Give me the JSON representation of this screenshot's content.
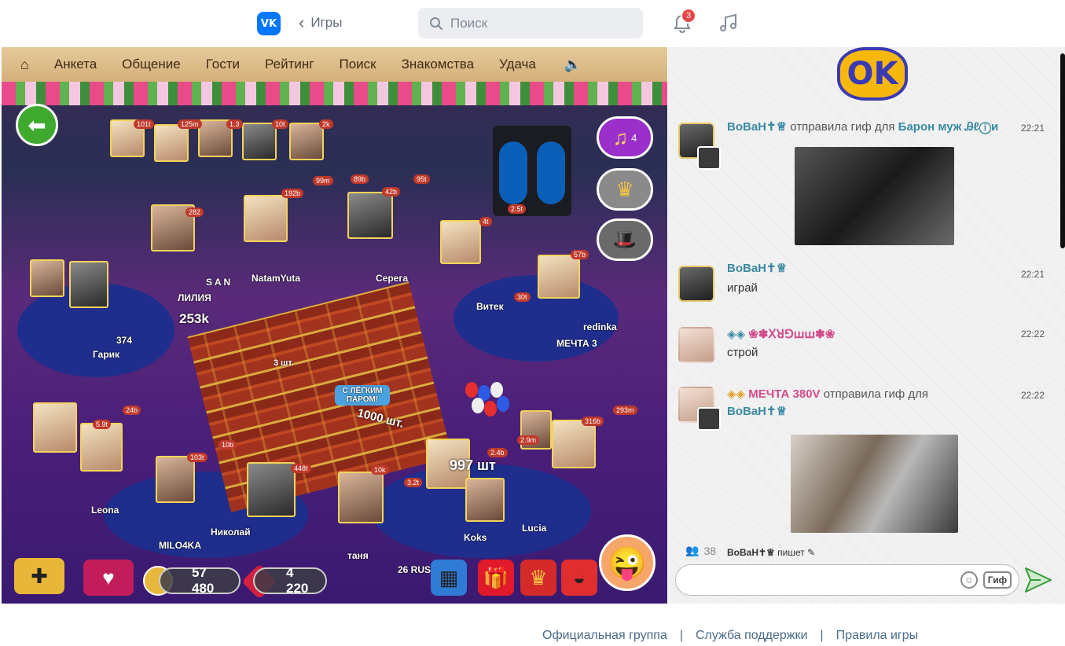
{
  "topbar": {
    "logo_text": "VK",
    "back_label": "Игры",
    "search_placeholder": "Поиск",
    "notifications_count": "3"
  },
  "game": {
    "nav": [
      "Анкета",
      "Общение",
      "Гости",
      "Рейтинг",
      "Поиск",
      "Знакомства",
      "Удача"
    ],
    "music_count": "4",
    "names": {
      "n1": "ЛИЛИЯ",
      "n2": "Гарик",
      "n3": "NatamYuta",
      "n4": "Серега",
      "n5": "Витек",
      "n6": "МЕЧТА 3",
      "n7": "Leona",
      "n8": "Николай",
      "n9": "MILO4KA",
      "n10": "таня",
      "n11": "Koks",
      "n12": "Lucia",
      "n13": "S A N",
      "n14": "redinka",
      "n15": "26 RUS"
    },
    "values": {
      "v1": "253k",
      "v2": "374",
      "v3": "3 шт.",
      "v4": "1000 шт.",
      "v5": "997 шт",
      "v6": "С ЛЁГКИМ ПАРОМ!",
      "t1": "101t",
      "t2": "125m",
      "t3": "10t",
      "t4": "2k",
      "t5": "192b",
      "t6": "282",
      "t7": "99m",
      "t8": "89b",
      "t9": "42b",
      "t10": "95t",
      "t11": "2.5t",
      "t12": "57b",
      "t13": "24b",
      "t14": "5.9t",
      "t15": "103t",
      "t16": "10b",
      "t17": "448t",
      "t18": "10k",
      "t19": "3.2t",
      "t20": "2.4b",
      "t21": "2.9m",
      "t22": "316b",
      "t23": "293m",
      "t24": "1.3",
      "t25": "4t",
      "t26": "30t"
    },
    "coins_amount": "57 480",
    "rubies_amount": "4 220"
  },
  "chat": {
    "messages": [
      {
        "nick": "BoBaH✝♕",
        "action": "отправила гиф для",
        "target": "Барон муж Ꭿℓⓘи",
        "time": "22:21"
      },
      {
        "nick": "BoBaH✝♕",
        "text": "играй",
        "time": "22:21"
      },
      {
        "nick": "❀✽ꓫꓤꓨꟺꟺ✽❀",
        "text": "строй",
        "time": "22:22"
      },
      {
        "nick": "МЕЧТА 380V",
        "action": "отправила гиф для",
        "target": "BoBaH✝♕",
        "time": "22:22"
      }
    ],
    "online_count": "38",
    "typing_nick": "BoBaH✝♕",
    "typing_text": "пишет",
    "gif_button": "Гиф"
  },
  "footer": {
    "links": [
      "Официальная группа",
      "Служба поддержки",
      "Правила игры"
    ],
    "separator": "|"
  },
  "colors": {
    "vk_blue": "#0077ff",
    "chat_nick": "#3b8aa3",
    "chat_nick_pink": "#d24b8a",
    "footer_link": "#4a6b8a"
  }
}
